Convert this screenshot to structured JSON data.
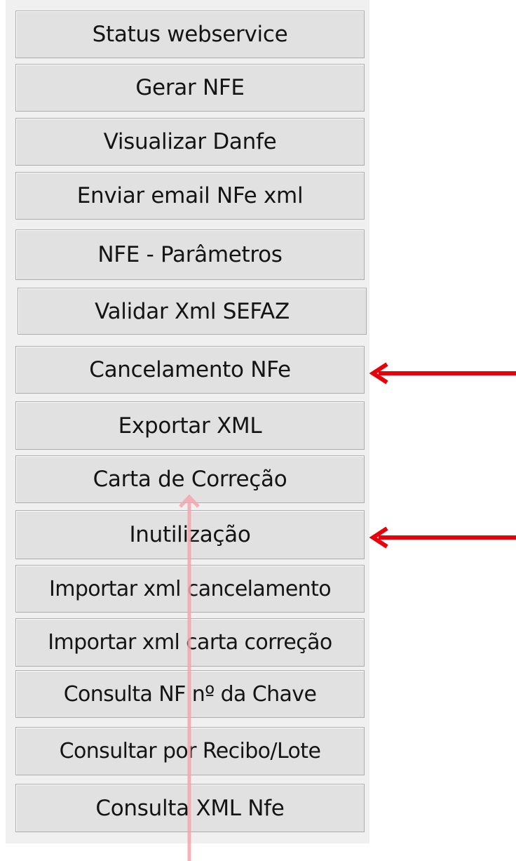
{
  "buttons": [
    "Status webservice",
    "Gerar NFE",
    "Visualizar Danfe",
    "Enviar email NFe xml",
    "NFE - Parâmetros",
    "Validar Xml SEFAZ",
    "Cancelamento NFe",
    "Exportar XML",
    "Carta de Correção",
    "Inutilização",
    "Importar xml cancelamento",
    "Importar xml carta correção",
    "Consulta NF nº da Chave",
    "Consultar por Recibo/Lote",
    "Consulta XML Nfe"
  ],
  "annotations": {
    "arrow_color": "#e8000b",
    "pointer_arrow_color": "#f4a6ae",
    "arrows": [
      "red-arrow-cancelamento",
      "red-arrow-inutilizacao",
      "pink-arrow-carta"
    ]
  }
}
